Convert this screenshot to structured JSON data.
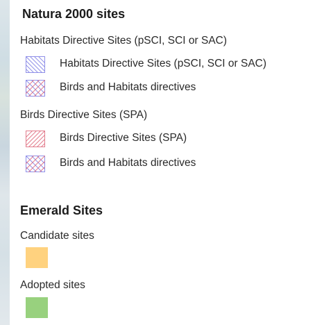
{
  "legend": {
    "natura": {
      "title": "Natura 2000 sites",
      "habitats": {
        "title": "Habitats Directive Sites (pSCI, SCI or SAC)",
        "items": [
          {
            "label": "Habitats Directive Sites (pSCI, SCI or SAC)",
            "stroke": "#8f8fe8",
            "pattern": "diagonal-hatch"
          },
          {
            "label": "Birds and Habitats directives",
            "stroke": "#e27c8c",
            "stroke2": "#8f8fe8",
            "pattern": "cross-hatch"
          }
        ]
      },
      "birds": {
        "title": "Birds Directive Sites (SPA)",
        "items": [
          {
            "label": "Birds Directive Sites (SPA)",
            "stroke": "#e27c8c",
            "pattern": "diagonal-hatch"
          },
          {
            "label": "Birds and Habitats directives",
            "stroke": "#e27c8c",
            "stroke2": "#8f8fe8",
            "pattern": "cross-hatch"
          }
        ]
      }
    },
    "emerald": {
      "title": "Emerald Sites",
      "candidate": {
        "title": "Candidate sites",
        "color": "#ffd27f"
      },
      "adopted": {
        "title": "Adopted sites",
        "color": "#98d17e"
      }
    }
  }
}
